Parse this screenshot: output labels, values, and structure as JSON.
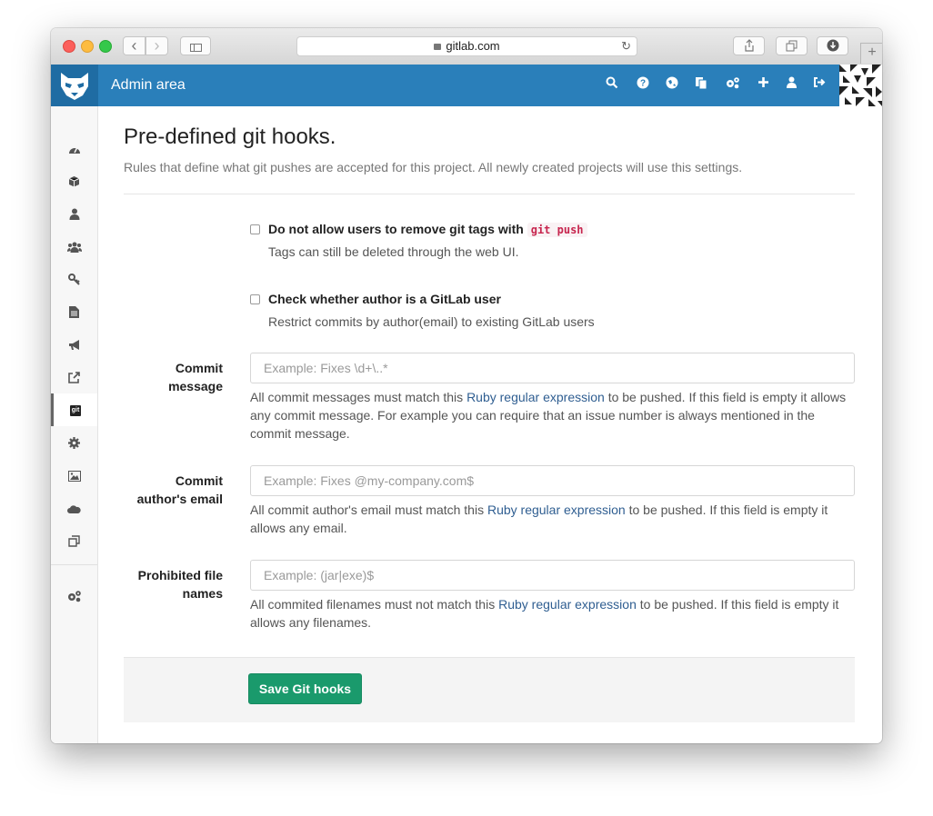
{
  "browser": {
    "url": "gitlab.com",
    "back_icon": "‹",
    "forward_icon": "›",
    "reload_icon": "↻",
    "new_tab_icon": "+"
  },
  "header": {
    "title": "Admin area",
    "icons": [
      "search-icon",
      "help-icon",
      "globe-icon",
      "copy-icon",
      "cogs-icon",
      "plus-icon",
      "user-icon",
      "sign-out-icon"
    ],
    "bg_color": "#2a7fba"
  },
  "sidebar": {
    "items": [
      {
        "name": "dashboard-icon",
        "glyph": "◔"
      },
      {
        "name": "projects-icon",
        "glyph": "◈"
      },
      {
        "name": "user-icon",
        "glyph": "●"
      },
      {
        "name": "groups-icon",
        "glyph": "●"
      },
      {
        "name": "key-icon",
        "glyph": "⚷"
      },
      {
        "name": "file-icon",
        "glyph": "▤"
      },
      {
        "name": "bullhorn-icon",
        "glyph": "◀"
      },
      {
        "name": "external-link-icon",
        "glyph": "↗"
      },
      {
        "name": "git-icon",
        "glyph": "git"
      },
      {
        "name": "gear-icon",
        "glyph": "✱"
      },
      {
        "name": "image-icon",
        "glyph": "▨"
      },
      {
        "name": "cloud-icon",
        "glyph": "☁"
      },
      {
        "name": "clone-icon",
        "glyph": "⧉"
      },
      {
        "name": "cogs-icon",
        "glyph": "⚙"
      }
    ]
  },
  "page": {
    "title": "Pre-defined git hooks.",
    "description": "Rules that define what git pushes are accepted for this project. All newly created projects will use this settings."
  },
  "checkboxes": {
    "deny_delete_tag": {
      "label": "Do not allow users to remove git tags with",
      "code": "git push",
      "help": "Tags can still be deleted through the web UI.",
      "checked": false
    },
    "member_check": {
      "label": "Check whether author is a GitLab user",
      "help": "Restrict commits by author(email) to existing GitLab users",
      "checked": false
    }
  },
  "fields": {
    "commit_message": {
      "label_line1": "Commit",
      "label_line2": "message",
      "placeholder": "Example: Fixes \\d+\\..*",
      "help_before": "All commit messages must match this ",
      "help_link": "Ruby regular expression",
      "help_after": " to be pushed. If this field is empty it allows any commit message. For example you can require that an issue number is always mentioned in the commit message."
    },
    "author_email": {
      "label_line1": "Commit",
      "label_line2": "author's email",
      "placeholder": "Example: Fixes @my-company.com$",
      "help_before": "All commit author's email must match this ",
      "help_link": "Ruby regular expression",
      "help_after": " to be pushed. If this field is empty it allows any email."
    },
    "file_names": {
      "label_line1": "Prohibited file",
      "label_line2": "names",
      "placeholder": "Example: (jar|exe)$",
      "help_before": "All commited filenames must not match this ",
      "help_link": "Ruby regular expression",
      "help_after": " to be pushed. If this field is empty it allows any filenames."
    }
  },
  "actions": {
    "save_label": "Save Git hooks",
    "save_color": "#1a9a6c"
  }
}
